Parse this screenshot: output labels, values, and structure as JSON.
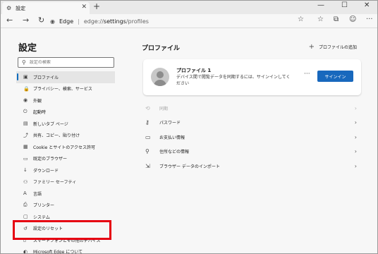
{
  "tab": {
    "title": "設定",
    "icon": "gear-icon",
    "close": "✕"
  },
  "tabstrip": {
    "new_tab": "+"
  },
  "window": {
    "minimize": "—",
    "maximize": "☐",
    "close": "✕"
  },
  "address": {
    "brand": "Edge",
    "separator": "|",
    "url_prefix": "edge://",
    "url_strong": "settings",
    "url_suffix": "/profiles"
  },
  "sidebar": {
    "title": "設定",
    "search_placeholder": "設定の検索",
    "items": [
      {
        "label": "プロファイル",
        "icon": "profile-icon",
        "glyph": "▣"
      },
      {
        "label": "プライバシー、検索、サービス",
        "icon": "lock-icon",
        "glyph": "🔒"
      },
      {
        "label": "外観",
        "icon": "appearance-icon",
        "glyph": "◉"
      },
      {
        "label": "起動時",
        "icon": "power-icon",
        "glyph": "⏻"
      },
      {
        "label": "新しいタブ ページ",
        "icon": "newtab-icon",
        "glyph": "▤"
      },
      {
        "label": "共有、コピー、貼り付け",
        "icon": "share-icon",
        "glyph": "⤴"
      },
      {
        "label": "Cookie とサイトのアクセス許可",
        "icon": "cookie-icon",
        "glyph": "▦"
      },
      {
        "label": "既定のブラウザー",
        "icon": "browser-icon",
        "glyph": "▭"
      },
      {
        "label": "ダウンロード",
        "icon": "download-icon",
        "glyph": "↓"
      },
      {
        "label": "ファミリー セーフティ",
        "icon": "family-icon",
        "glyph": "⚇"
      },
      {
        "label": "言語",
        "icon": "language-icon",
        "glyph": "A"
      },
      {
        "label": "プリンター",
        "icon": "printer-icon",
        "glyph": "⎙"
      },
      {
        "label": "システム",
        "icon": "system-icon",
        "glyph": "▢"
      },
      {
        "label": "設定のリセット",
        "icon": "reset-icon",
        "glyph": "↺"
      },
      {
        "label": "スマートフォンとその他のデバイス",
        "icon": "phone-icon",
        "glyph": "▯"
      },
      {
        "label": "Microsoft Edge について",
        "icon": "edge-icon",
        "glyph": "◐"
      }
    ]
  },
  "main": {
    "title": "プロファイル",
    "add_profile": "プロファイルの追加",
    "card": {
      "name": "プロファイル 1",
      "desc": "デバイス間で閲覧データを同期するには、サインインしてください",
      "more": "···",
      "signin": "サインイン"
    },
    "rows": [
      {
        "label": "同期",
        "icon": "sync-icon",
        "glyph": "⟲",
        "disabled": true
      },
      {
        "label": "パスワード",
        "icon": "key-icon",
        "glyph": "⚷",
        "disabled": false
      },
      {
        "label": "お支払い情報",
        "icon": "card-icon",
        "glyph": "▭",
        "disabled": false
      },
      {
        "label": "住所などの情報",
        "icon": "location-icon",
        "glyph": "⚲",
        "disabled": false
      },
      {
        "label": "ブラウザー データのインポート",
        "icon": "import-icon",
        "glyph": "⇲",
        "disabled": false
      }
    ]
  }
}
